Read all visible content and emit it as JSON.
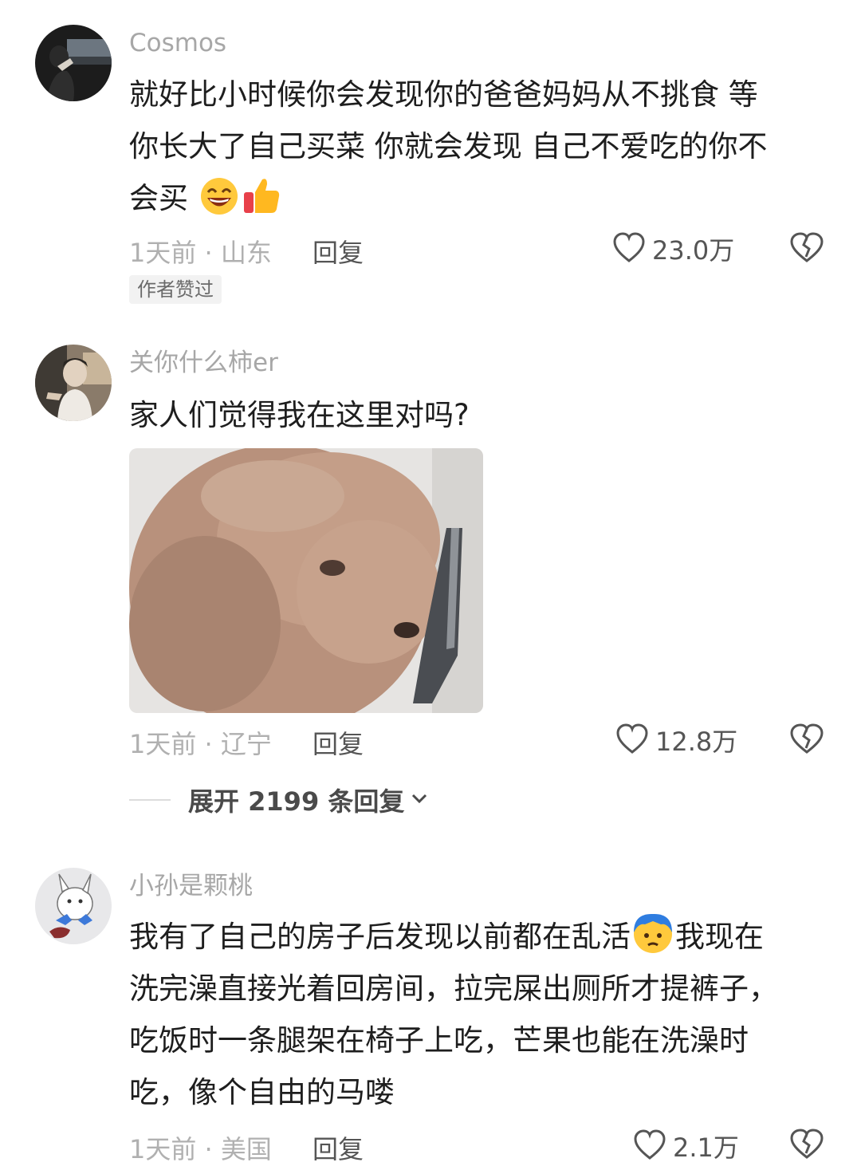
{
  "comments": [
    {
      "username": "Cosmos",
      "lines": [
        "就好比小时候你会发现你的爸爸妈妈从不挑食 等",
        "你长大了自己买菜 你就会发现 自己不爱吃的你不",
        "会买"
      ],
      "emojis": [
        "grinning-face-icon",
        "thumbs-up-icon"
      ],
      "time_location": "1天前 · 山东",
      "reply_label": "回复",
      "likes": "23.0万",
      "badge": "作者赞过"
    },
    {
      "username": "关你什么柿er",
      "lines": [
        "家人们觉得我在这里对吗?"
      ],
      "image": "poodle-with-knife-meme",
      "time_location": "1天前 · 辽宁",
      "reply_label": "回复",
      "likes": "12.8万",
      "expand_label": "展开 2199 条回复"
    },
    {
      "username": "小孙是颗桃",
      "lines": [
        "我有了自己的房子后发现以前都在乱活",
        "我现在",
        "洗完澡直接光着回房间，拉完屎出厕所才提裤子，",
        "吃饭时一条腿架在椅子上吃，芒果也能在洗澡时",
        "吃，像个自由的马喽"
      ],
      "emojis": [
        "sweating-face-icon"
      ],
      "time_location": "1天前 · 美国",
      "reply_label": "回复",
      "likes": "2.1万"
    }
  ],
  "colors": {
    "username": "#a7a7a7",
    "text": "#1e1e1e",
    "meta": "#b0b0b0",
    "action": "#555555",
    "badge_bg": "#f2f2f2"
  }
}
